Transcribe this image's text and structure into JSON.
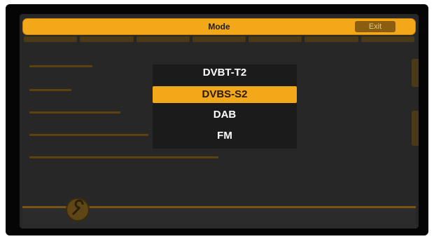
{
  "header": {
    "title": "Mode",
    "exit_label": "Exit"
  },
  "mode_menu": {
    "items": [
      {
        "label": "DVBT-T2",
        "selected": false
      },
      {
        "label": "DVBS-S2",
        "selected": true
      },
      {
        "label": "DAB",
        "selected": false
      },
      {
        "label": "FM",
        "selected": false
      }
    ]
  },
  "colors": {
    "accent": "#f3a81a",
    "screen_bg": "#272727",
    "menu_bg": "#1b1b1b"
  },
  "icons": {
    "settings": "wrench-icon"
  }
}
